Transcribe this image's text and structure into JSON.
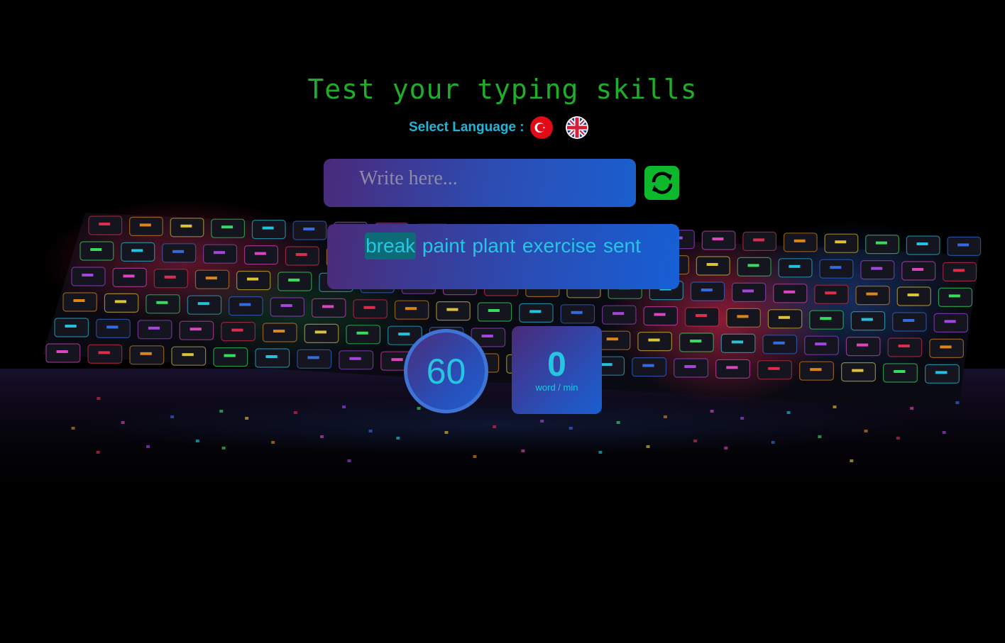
{
  "page": {
    "title": "Test your typing skills"
  },
  "language": {
    "label": "Select Language :",
    "options": [
      {
        "code": "tr",
        "icon": "turkey-flag-icon"
      },
      {
        "code": "en",
        "icon": "uk-flag-icon"
      }
    ]
  },
  "input": {
    "placeholder": "Write here...",
    "value": ""
  },
  "refresh": {
    "icon": "refresh-icon",
    "color": "#0db82c"
  },
  "words": {
    "items": [
      "break",
      "paint",
      "plant",
      "exercise",
      "sent"
    ],
    "current_index": 0
  },
  "timer": {
    "seconds": "60"
  },
  "wpm": {
    "value": "0",
    "unit": "word / min"
  },
  "theme": {
    "title_color": "#1fae2a",
    "accent_text": "#25c6e2",
    "highlight": "#0d6b78"
  }
}
